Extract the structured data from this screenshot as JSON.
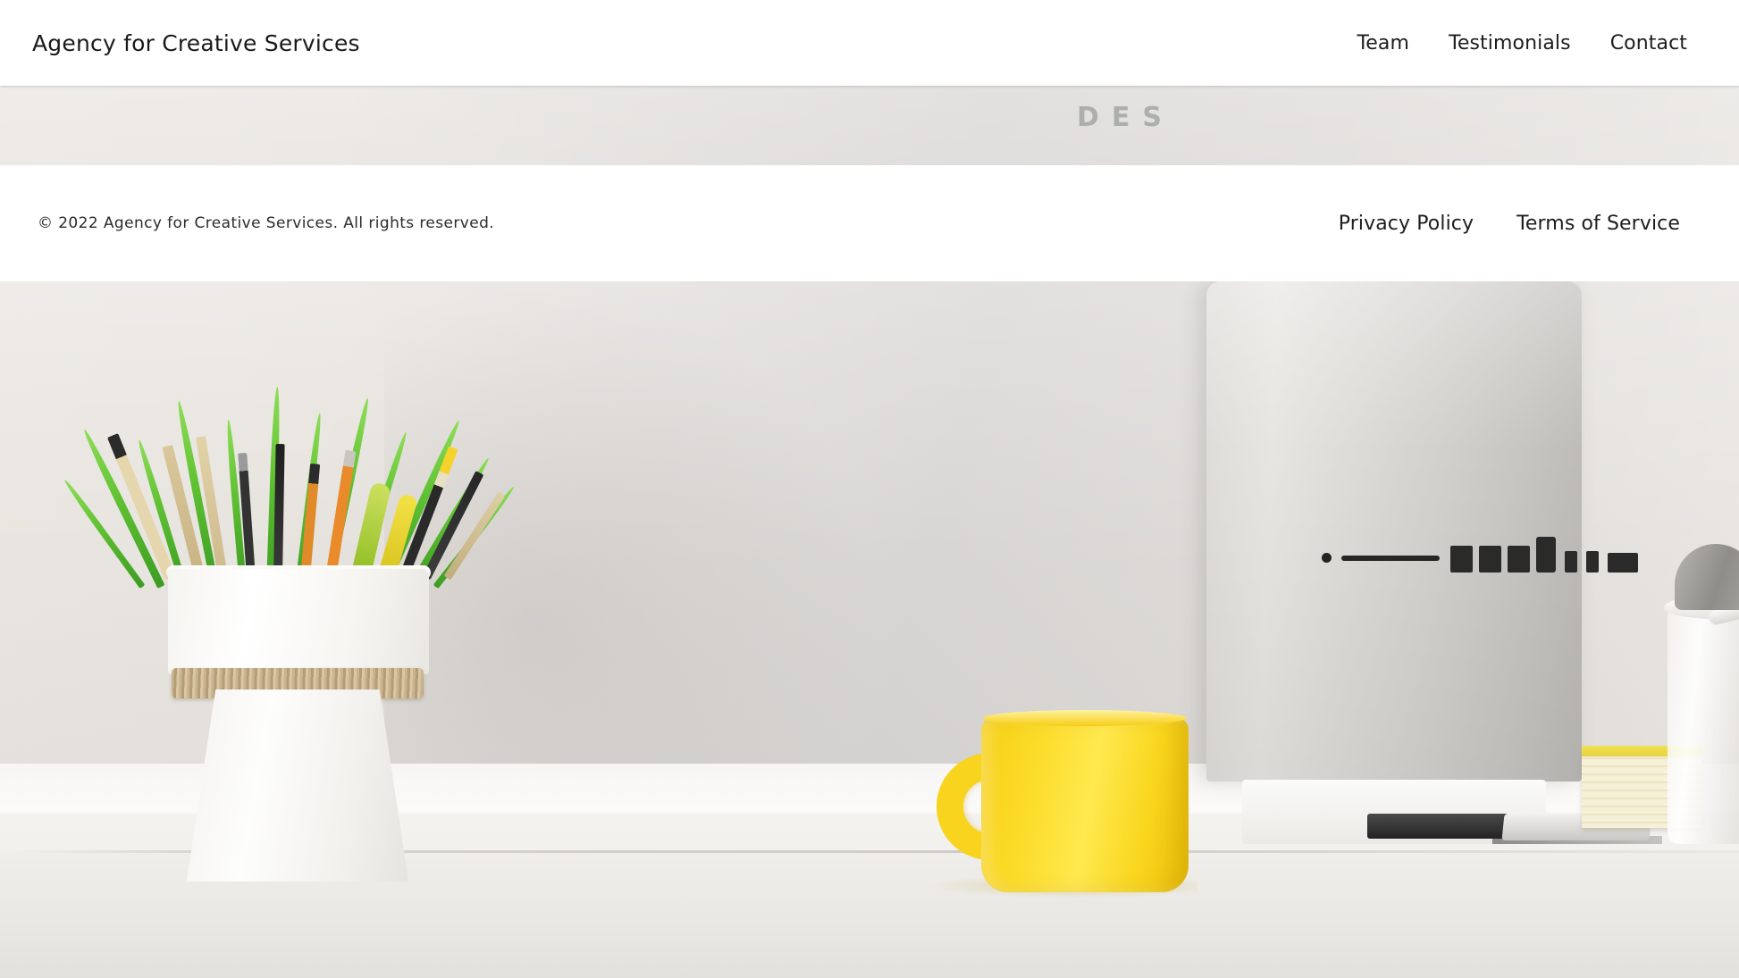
{
  "header": {
    "logo": "Agency for Creative Services",
    "nav": [
      {
        "label": "Team"
      },
      {
        "label": "Testimonials"
      },
      {
        "label": "Contact"
      }
    ]
  },
  "footer": {
    "copyright": "© 2022 Agency for Creative Services. All rights reserved.",
    "links": [
      {
        "label": "Privacy Policy"
      },
      {
        "label": "Terms of Service"
      }
    ]
  },
  "hero": {
    "wall_text": "DES",
    "alt": "Desk with white pot of grass and pencils, yellow coffee mug, iMac computer, keyboard, sticky note pad and a tumbler"
  },
  "colors": {
    "bar_background": "#ffffff",
    "text": "#1d1d1d",
    "mug_yellow": "#f8d41e",
    "plant_green": "#5fc132",
    "wall": "#e2dfdb",
    "desk": "#f7f6f4"
  }
}
